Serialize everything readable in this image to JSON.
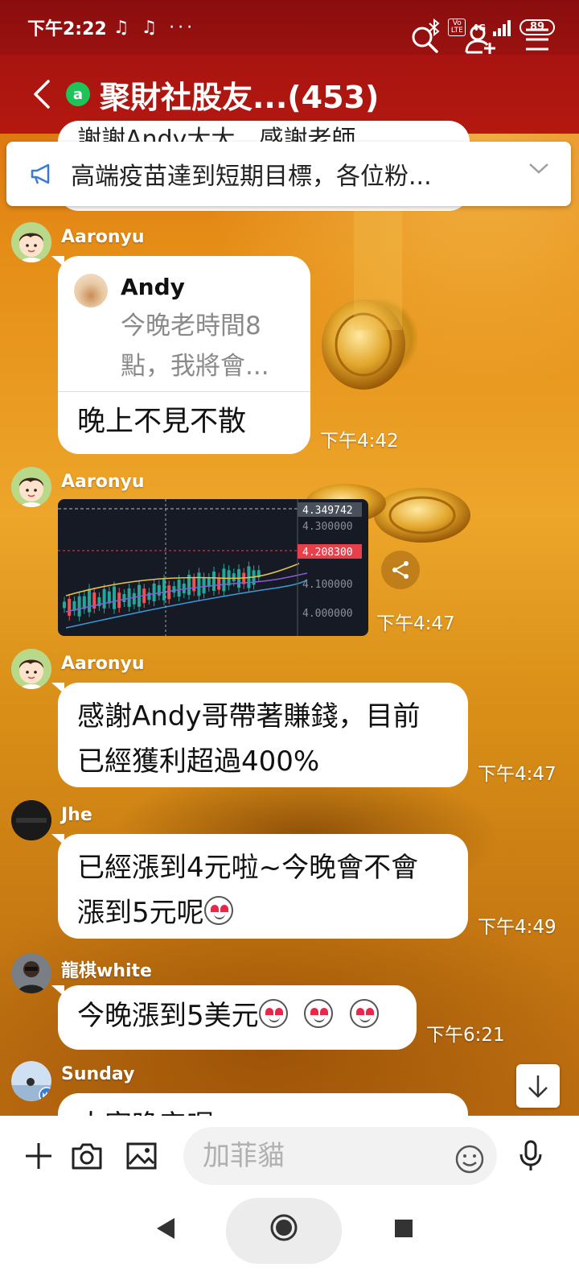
{
  "status_bar": {
    "time": "下午2:22",
    "notifications": "♫ ♫ ···",
    "network": "4G",
    "volte": "Vo LTE",
    "battery": "89"
  },
  "header": {
    "title": "聚財社股友...(453)",
    "online_badge": "a",
    "icons": [
      "back-icon",
      "search-icon",
      "add-friend-icon",
      "menu-icon"
    ]
  },
  "announcement": {
    "text": "高端疫苗達到短期目標，各位粉...",
    "icon": "megaphone-icon"
  },
  "peek_message": {
    "text": "謝謝Andy大大，感謝老師"
  },
  "messages": [
    {
      "sender": "Aaronyu",
      "reply_to": {
        "name": "Andy",
        "text": "今晚老時間8點，我將會..."
      },
      "text": "晚上不見不散",
      "time": "下午4:42"
    },
    {
      "sender": "Aaronyu",
      "image": "chart-screenshot",
      "time": "下午4:47"
    },
    {
      "sender": "Aaronyu",
      "text_line1": "感謝Andy哥帶著賺錢，目前",
      "text_line2": "已經獲利超過400%",
      "time": "下午4:47"
    },
    {
      "sender": "Jhe",
      "text_line1": "已經漲到4元啦~今晚會不會",
      "text_line2": "漲到5元呢",
      "time": "下午4:49"
    },
    {
      "sender": "龍棋white",
      "text": "今晚漲到5美元",
      "time": "下午6:21"
    },
    {
      "sender": "Sunday",
      "text": "大家晚安喔"
    }
  ],
  "chart_image": {
    "price_labels": [
      "4.349742",
      "4.300000",
      "4.208300",
      "4.100000",
      "4.000000"
    ],
    "highlight_color": "#e8404b"
  },
  "input": {
    "placeholder": "加菲貓",
    "icons": [
      "plus-icon",
      "camera-icon",
      "image-icon",
      "emoji-icon",
      "mic-icon"
    ]
  },
  "colors": {
    "header": "#b4180f",
    "status_bar": "#8a0d0d",
    "online": "#20c35a"
  }
}
